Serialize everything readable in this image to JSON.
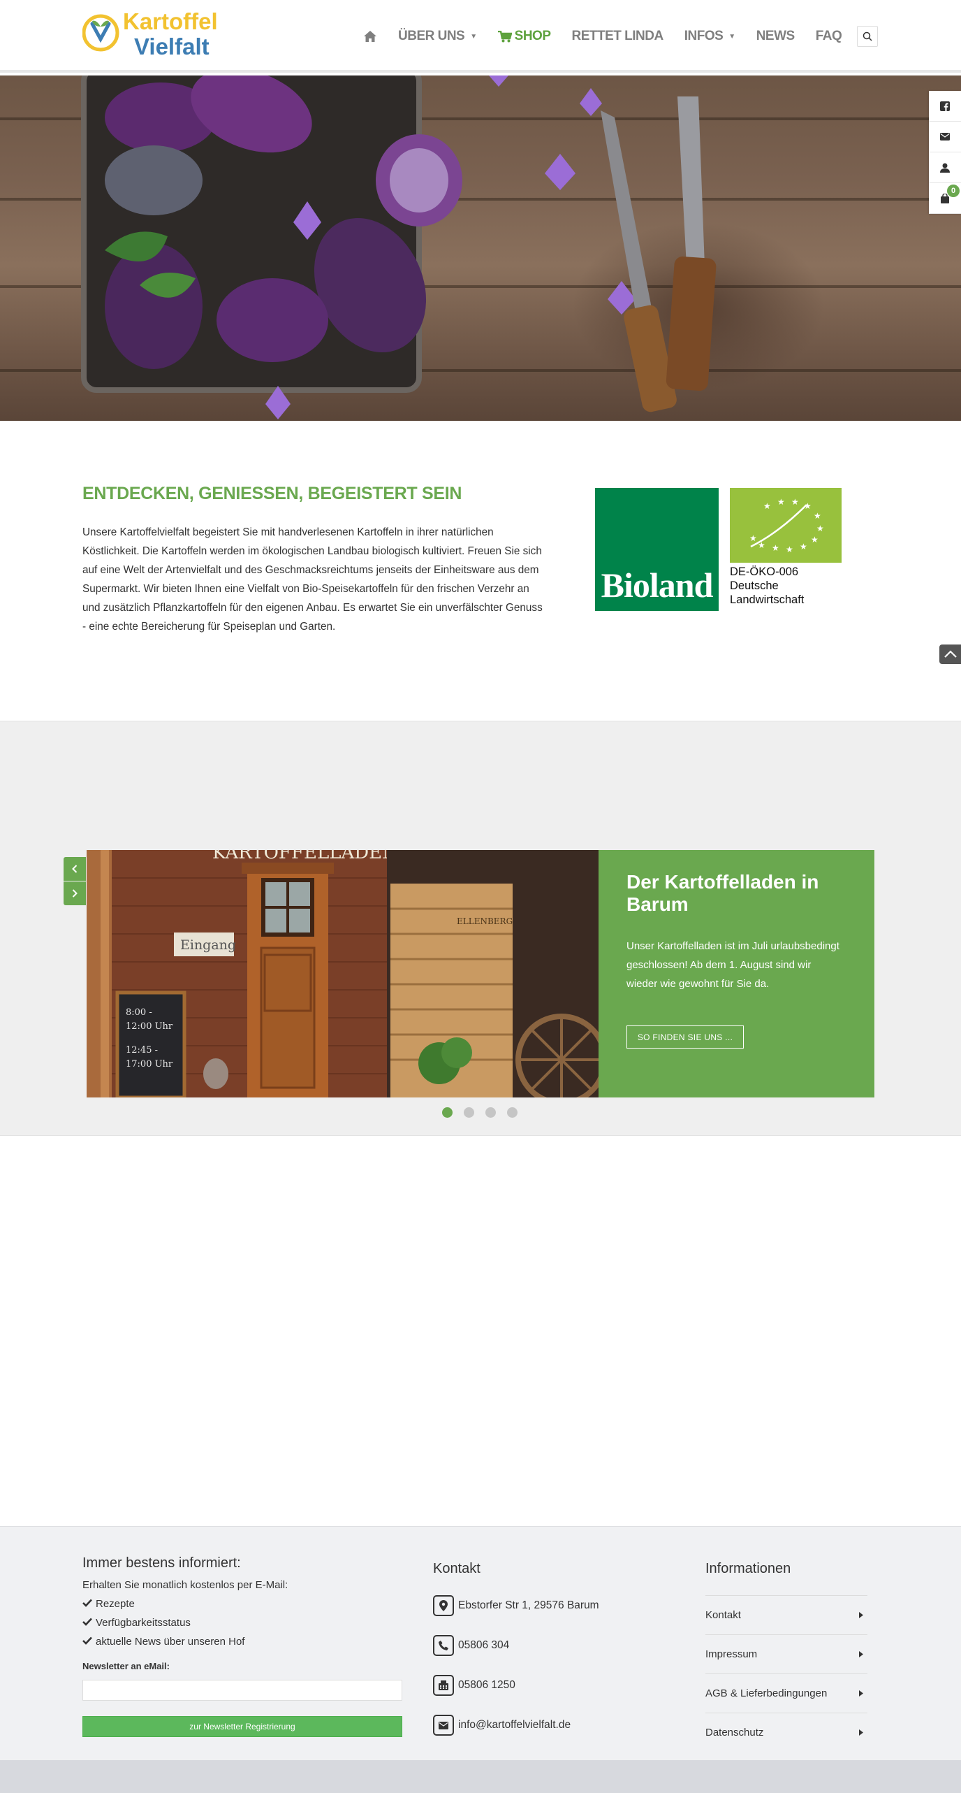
{
  "header": {
    "logo": {
      "line1": "Kartoffel",
      "line2": "Vielfalt"
    },
    "nav": [
      {
        "label": "ÜBER UNS",
        "dropdown": true
      },
      {
        "label": "SHOP",
        "dropdown": false
      },
      {
        "label": "RETTET LINDA",
        "dropdown": false
      },
      {
        "label": "INFOS",
        "dropdown": true
      },
      {
        "label": "NEWS",
        "dropdown": false
      },
      {
        "label": "FAQ",
        "dropdown": false
      }
    ]
  },
  "side_bar": {
    "icons": [
      "facebook-icon",
      "mail-icon",
      "user-icon",
      "cart-icon"
    ],
    "cart_count": "0"
  },
  "intro": {
    "title": "ENTDECKEN, GENIESSEN, BEGEISTERT SEIN",
    "text": "Unsere Kartoffelvielfalt begeistert Sie mit handverlesenen Kartoffeln in ihrer natürlichen Köstlichkeit. Die Kartoffeln werden im ökologischen Landbau biologisch kultiviert. Freuen Sie sich auf eine Welt der Artenvielfalt und des Geschmacksreichtums jenseits der Einheitsware aus dem Supermarkt. Wir bieten Ihnen eine Vielfalt von Bio-Speisekartoffeln für den frischen Verzehr an und zusätzlich Pflanzkartoffeln für den eigenen Anbau. Es erwartet Sie ein unverfälschter Genuss - eine echte Bereicherung für Speiseplan und Garten.",
    "bioland_label": "Bioland",
    "eu_code": "DE-ÖKO-006",
    "eu_line2": "Deutsche",
    "eu_line3": "Landwirtschaft"
  },
  "slider": {
    "image_sign_top": "KARTOFFELLADEN",
    "image_sign_door": "Eingang",
    "image_board_1": "8:00 -",
    "image_board_2": "12:00 Uhr",
    "image_board_3": "12:45 -",
    "image_board_4": "17:00 Uhr",
    "image_crate": "ELLENBERG",
    "title": "Der Kartoffelladen in Barum",
    "text": "Unser Kartoffelladen ist im Juli urlaubsbedingt geschlossen! Ab dem 1. August sind wir wieder wie gewohnt für Sie da.",
    "button_label": "SO FINDEN SIE UNS ...",
    "slide_count": 4,
    "active_slide": 1
  },
  "footer": {
    "newsletter": {
      "heading": "Immer bestens informiert:",
      "subtitle": "Erhalten Sie monatlich kostenlos per E-Mail:",
      "bullets": [
        "Rezepte",
        "Verfügbarkeitsstatus",
        "aktuelle News über unseren Hof"
      ],
      "input_label": "Newsletter an eMail:",
      "input_value": "",
      "input_placeholder": "",
      "button_label": "zur Newsletter Registrierung"
    },
    "contact": {
      "heading": "Kontakt",
      "address": "Ebstorfer Str 1, 29576 Barum",
      "phone": "05806 304",
      "fax": "05806 1250",
      "email": "info@kartoffelvielfalt.de"
    },
    "info": {
      "heading": "Informationen",
      "links": [
        "Kontakt",
        "Impressum",
        "AGB & Lieferbedingungen",
        "Datenschutz"
      ]
    }
  },
  "colors": {
    "accent_green": "#6aa84f",
    "button_green": "#5cb85c",
    "nav_grey": "#7f7f7f",
    "bioland_green": "#00834a",
    "eu_leaf_green": "#98c13d",
    "logo_yellow": "#f2c230",
    "logo_blue": "#3d7db3"
  }
}
